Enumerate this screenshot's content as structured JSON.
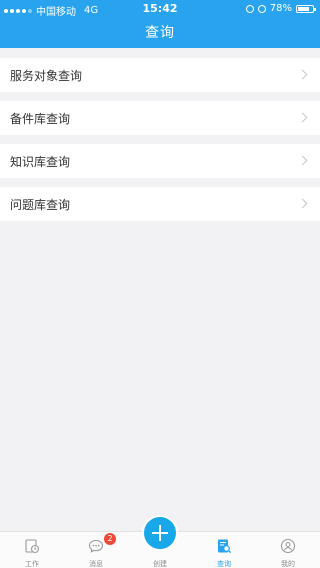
{
  "status_bar": {
    "carrier": "中国移动",
    "network": "4G",
    "time": "15:42",
    "battery_text": "78%",
    "battery_level": 0.78
  },
  "header": {
    "title": "查询"
  },
  "menu": {
    "items": [
      {
        "label": "服务对象查询"
      },
      {
        "label": "备件库查询"
      },
      {
        "label": "知识库查询"
      },
      {
        "label": "问题库查询"
      }
    ]
  },
  "tabbar": {
    "tabs": [
      {
        "label": "工作",
        "icon": "work-icon"
      },
      {
        "label": "消息",
        "icon": "message-icon",
        "badge": "2"
      },
      {
        "label": "创建",
        "icon": "plus-icon"
      },
      {
        "label": "查询",
        "icon": "query-icon",
        "active": true
      },
      {
        "label": "我的",
        "icon": "profile-icon"
      }
    ]
  },
  "colors": {
    "primary": "#2aa3ef",
    "create_button": "#18a8ea",
    "badge": "#f0493a",
    "background": "#f2f2f4"
  }
}
